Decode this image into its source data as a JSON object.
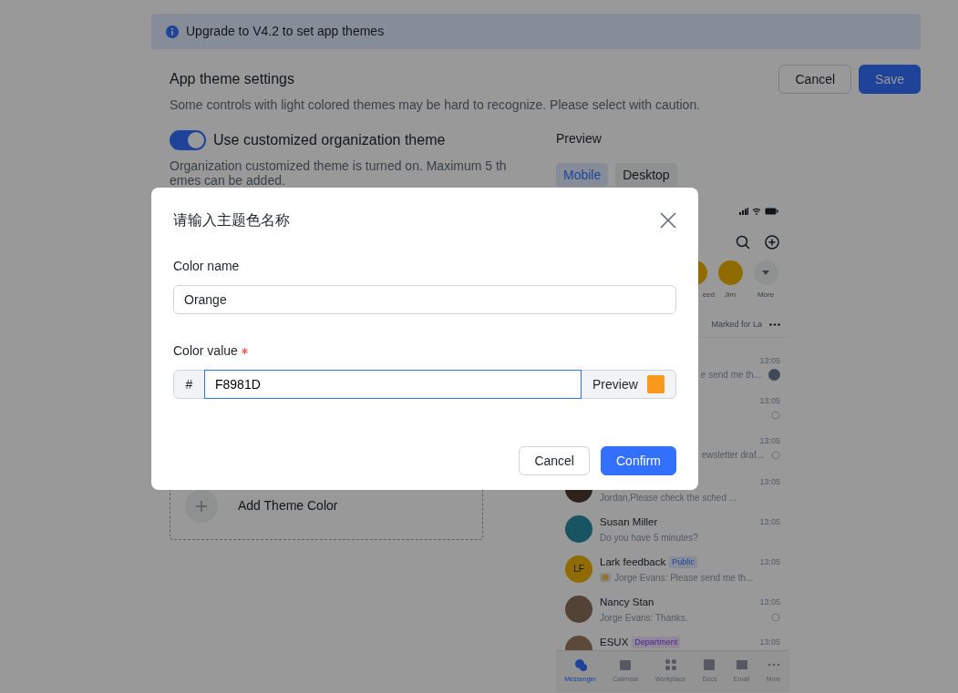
{
  "alert": {
    "text": "Upgrade to V4.2 to set app themes"
  },
  "settings": {
    "title": "App theme settings",
    "description": "Some controls with light colored themes may be hard to recognize. Please select with caution.",
    "buttons": [
      {
        "label": "Cancel",
        "kind": "secondary"
      },
      {
        "label": "Save",
        "kind": "primary"
      }
    ]
  },
  "org_theme": {
    "on": true,
    "label": "Use customized organization theme",
    "note": "Organization customized theme is turned on. Maximum 5 themes can be added."
  },
  "add_theme": {
    "label": "Add Theme Color"
  },
  "preview": {
    "title": "Preview",
    "tabs": [
      {
        "label": "Mobile",
        "selected": true
      },
      {
        "label": "Desktop",
        "selected": false
      }
    ],
    "phone": {
      "contacts": [
        {
          "kind": "covered",
          "label": "eed"
        },
        {
          "kind": "person",
          "label": "Jim"
        },
        {
          "kind": "more",
          "label": "More"
        }
      ],
      "filters": [
        {
          "label": "Marked for La"
        }
      ],
      "chats": [
        {
          "kind": "covered",
          "time": "13:05",
          "message": "e send me th...",
          "seen_by_avatar": true
        },
        {
          "kind": "covered",
          "time": "13:05",
          "read_receipt": true
        },
        {
          "kind": "covered",
          "time": "13:05",
          "message": "ewsletter draf...",
          "read_receipt": true
        },
        {
          "kind": "chat",
          "time": "13:05",
          "message": "Jordan,Please check the sched ..."
        },
        {
          "kind": "chat",
          "name": "Susan Miller",
          "time": "13:05",
          "message": "Do you have 5 minutes?"
        },
        {
          "kind": "chat",
          "initials": "LF",
          "name": "Lark feedback",
          "tag": {
            "text": "Public",
            "kind": "public"
          },
          "time": "13:05",
          "message": "Jorge Evans: Please send me th...",
          "emoji": true
        },
        {
          "kind": "chat",
          "name": "Nancy Stan",
          "time": "13:05",
          "message": "Jorge Evans: Thanks.",
          "read_receipt": true
        },
        {
          "kind": "chat",
          "name": "ESUX",
          "tag": {
            "text": "Department",
            "kind": "department"
          },
          "time": "13:05"
        }
      ],
      "nav": [
        {
          "label": "Messenger",
          "selected": true
        },
        {
          "label": "Calendar",
          "selected": false
        },
        {
          "label": "Workplace",
          "selected": false
        },
        {
          "label": "Docs",
          "selected": false
        },
        {
          "label": "Email",
          "selected": false
        },
        {
          "label": "More",
          "selected": false
        }
      ]
    }
  },
  "dialog": {
    "title": "请输入主题色名称",
    "name_field": {
      "label": "Color name",
      "value": "Orange"
    },
    "value_field": {
      "label": "Color value",
      "required": true,
      "prefix": "#",
      "value": "F8981D",
      "preview_label": "Preview"
    },
    "buttons": [
      {
        "label": "Cancel",
        "kind": "secondary"
      },
      {
        "label": "Confirm",
        "kind": "primary"
      }
    ]
  }
}
